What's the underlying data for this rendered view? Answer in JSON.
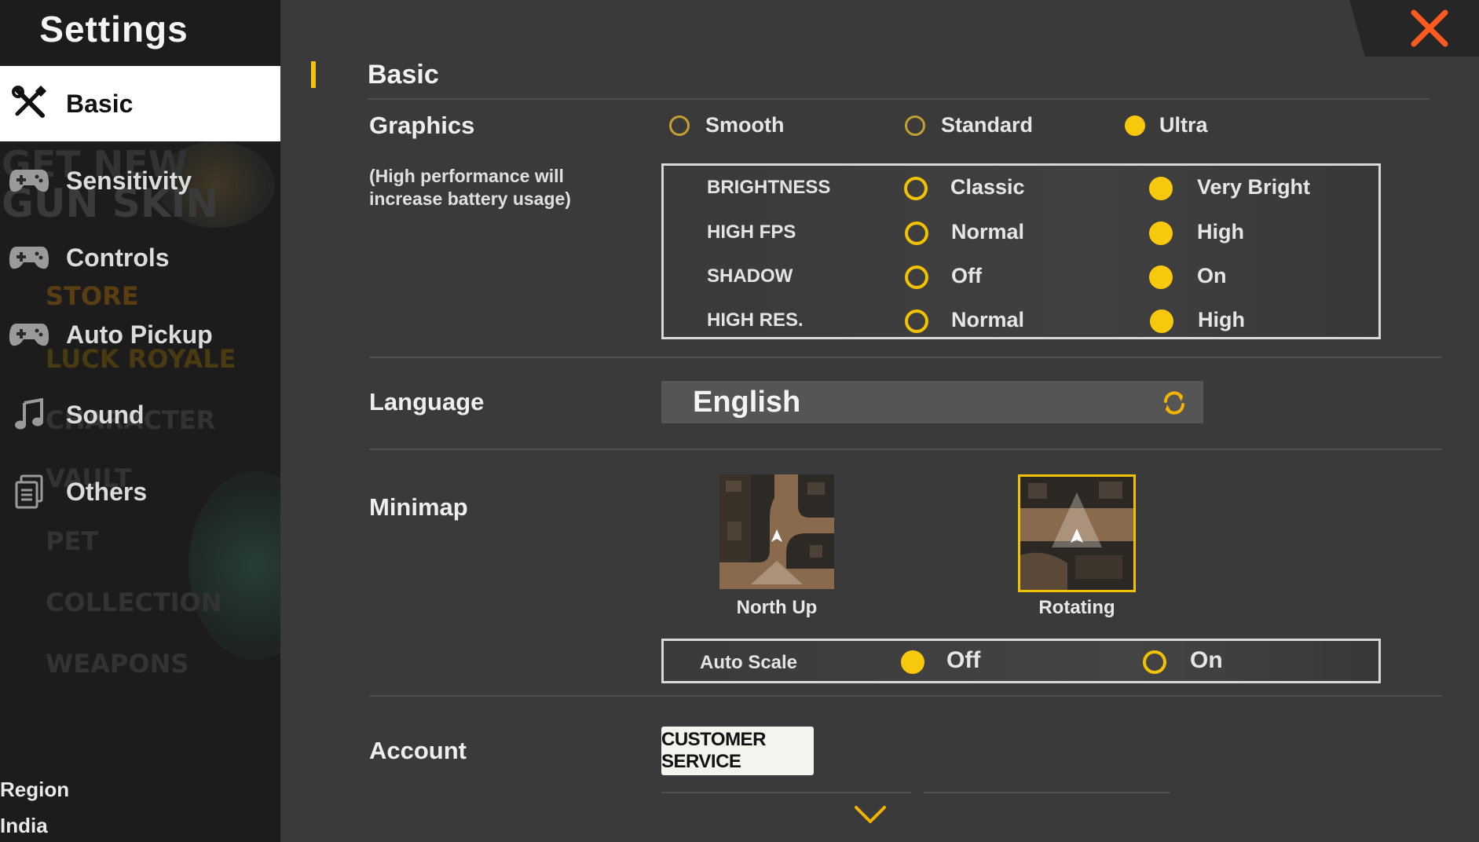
{
  "sidebar": {
    "title": "Settings",
    "items": [
      {
        "label": "Basic",
        "icon": "tools-icon",
        "active": true
      },
      {
        "label": "Sensitivity",
        "icon": "gamepad-icon"
      },
      {
        "label": "Controls",
        "icon": "gamepad-icon"
      },
      {
        "label": "Auto Pickup",
        "icon": "gamepad-icon"
      },
      {
        "label": "Sound",
        "icon": "music-note-icon"
      },
      {
        "label": "Others",
        "icon": "document-icon"
      }
    ],
    "background_words": [
      "GET NEW",
      "GUN SKIN",
      "STORE",
      "LUCK ROYALE",
      "CHARACTER",
      "VAULT",
      "PET",
      "COLLECTION",
      "WEAPONS"
    ],
    "region_label": "Region",
    "region_value": "India"
  },
  "section": {
    "title": "Basic"
  },
  "graphics": {
    "label": "Graphics",
    "note_line1": "(High performance will",
    "note_line2": "increase battery usage)",
    "options": [
      "Smooth",
      "Standard",
      "Ultra"
    ],
    "selected": "Ultra",
    "details": [
      {
        "name": "BRIGHTNESS",
        "opt1": "Classic",
        "opt2": "Very Bright",
        "selected": "Very Bright"
      },
      {
        "name": "HIGH FPS",
        "opt1": "Normal",
        "opt2": "High",
        "selected": "High"
      },
      {
        "name": "SHADOW",
        "opt1": "Off",
        "opt2": "On",
        "selected": "On"
      },
      {
        "name": "HIGH RES.",
        "opt1": "Normal",
        "opt2": "High",
        "selected": "High"
      }
    ]
  },
  "language": {
    "label": "Language",
    "value": "English"
  },
  "minimap": {
    "label": "Minimap",
    "options": [
      "North Up",
      "Rotating"
    ],
    "selected": "Rotating",
    "auto_scale": {
      "label": "Auto Scale",
      "opt1": "Off",
      "opt2": "On",
      "selected": "Off"
    }
  },
  "account": {
    "label": "Account",
    "button": "CUSTOMER SERVICE"
  },
  "colors": {
    "accent": "#f7c80c",
    "close": "#ff5a1f",
    "panel": "#3a3a3a",
    "sidebar": "#1c1c1c"
  }
}
